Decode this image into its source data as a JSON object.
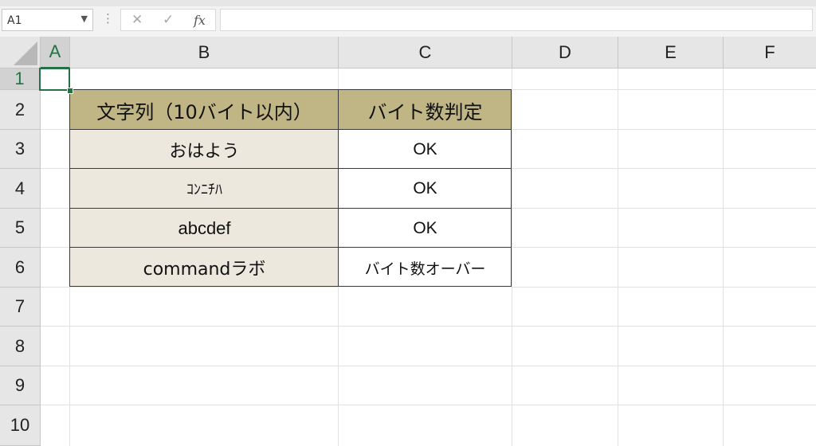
{
  "formula_bar": {
    "name_box": "A1",
    "separator": "⋮",
    "cancel_glyph": "✕",
    "enter_glyph": "✓",
    "fx_label": "fx",
    "formula_value": ""
  },
  "columns": [
    "A",
    "B",
    "C",
    "D",
    "E",
    "F"
  ],
  "rows": [
    "1",
    "2",
    "3",
    "4",
    "5",
    "6",
    "7",
    "8",
    "9",
    "10"
  ],
  "table": {
    "header": {
      "b": "文字列（10バイト以内）",
      "c": "バイト数判定"
    },
    "rows": [
      {
        "b": "おはよう",
        "c": "OK"
      },
      {
        "b": "ｺﾝﾆﾁﾊ",
        "c": "OK"
      },
      {
        "b": "abcdef",
        "c": "OK"
      },
      {
        "b": "commandラボ",
        "c": "バイト数オーバー"
      }
    ]
  },
  "colors": {
    "header_fill": "#bfb585",
    "label_fill": "#ece8de",
    "selection": "#217346"
  },
  "icons": {
    "name_box_dropdown": "chevron-down-icon",
    "cancel": "close-icon",
    "enter": "check-icon",
    "insert_function": "function-icon",
    "select_all": "select-all-triangle-icon"
  }
}
